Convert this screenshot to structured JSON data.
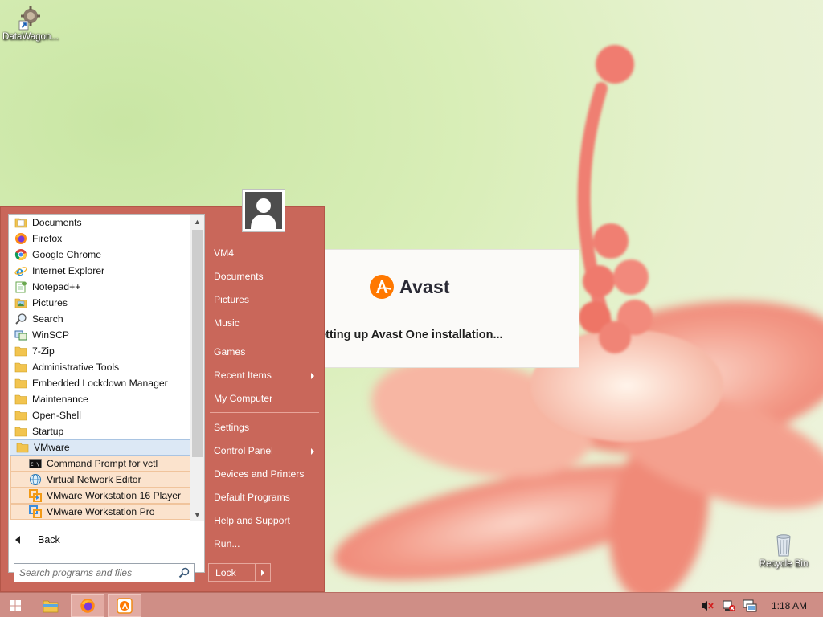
{
  "desktop": {
    "icons": [
      {
        "label": "DataWagon...",
        "icon": "datawagon-shortcut-icon"
      },
      {
        "label": "Recycle Bin",
        "icon": "recycle-bin-icon"
      }
    ]
  },
  "avast_dialog": {
    "brand": "Avast",
    "status": "etting up Avast One installation...",
    "accent_color": "#ff7800"
  },
  "start_menu": {
    "programs": [
      {
        "label": "Documents",
        "icon": "folder-docs-icon"
      },
      {
        "label": "Firefox",
        "icon": "firefox-icon"
      },
      {
        "label": "Google Chrome",
        "icon": "chrome-icon"
      },
      {
        "label": "Internet Explorer",
        "icon": "ie-icon"
      },
      {
        "label": "Notepad++",
        "icon": "notepadpp-icon"
      },
      {
        "label": "Pictures",
        "icon": "folder-pictures-icon"
      },
      {
        "label": "Search",
        "icon": "search-icon"
      },
      {
        "label": "WinSCP",
        "icon": "winscp-icon"
      },
      {
        "label": "7-Zip",
        "icon": "folder-icon"
      },
      {
        "label": "Administrative Tools",
        "icon": "folder-icon"
      },
      {
        "label": "Embedded Lockdown Manager",
        "icon": "folder-icon"
      },
      {
        "label": "Maintenance",
        "icon": "folder-icon"
      },
      {
        "label": "Open-Shell",
        "icon": "folder-icon"
      },
      {
        "label": "Startup",
        "icon": "folder-icon"
      },
      {
        "label": "VMware",
        "icon": "folder-icon"
      }
    ],
    "vmware_items": [
      {
        "label": "Command Prompt for vctl",
        "icon": "cmd-icon"
      },
      {
        "label": "Virtual Network Editor",
        "icon": "network-editor-icon"
      },
      {
        "label": "VMware Workstation 16 Player",
        "icon": "vmware-player-icon"
      },
      {
        "label": "VMware Workstation Pro",
        "icon": "vmware-pro-icon"
      }
    ],
    "back_label": "Back",
    "search_placeholder": "Search programs and files",
    "right_items": {
      "user": "VM4",
      "documents": "Documents",
      "pictures": "Pictures",
      "music": "Music",
      "games": "Games",
      "recent_items": "Recent Items",
      "my_computer": "My Computer",
      "settings": "Settings",
      "control_panel": "Control Panel",
      "devices_printers": "Devices and Printers",
      "default_programs": "Default Programs",
      "help_support": "Help and Support",
      "run": "Run..."
    },
    "lock_label": "Lock",
    "theme_color": "#c9675a"
  },
  "taskbar": {
    "clock": "1:18 AM",
    "pinned": [
      "start-icon",
      "file-explorer-icon",
      "firefox-icon",
      "avast-icon"
    ],
    "tray": [
      "volume-muted-icon",
      "network-error-icon",
      "monitor-icon"
    ]
  }
}
